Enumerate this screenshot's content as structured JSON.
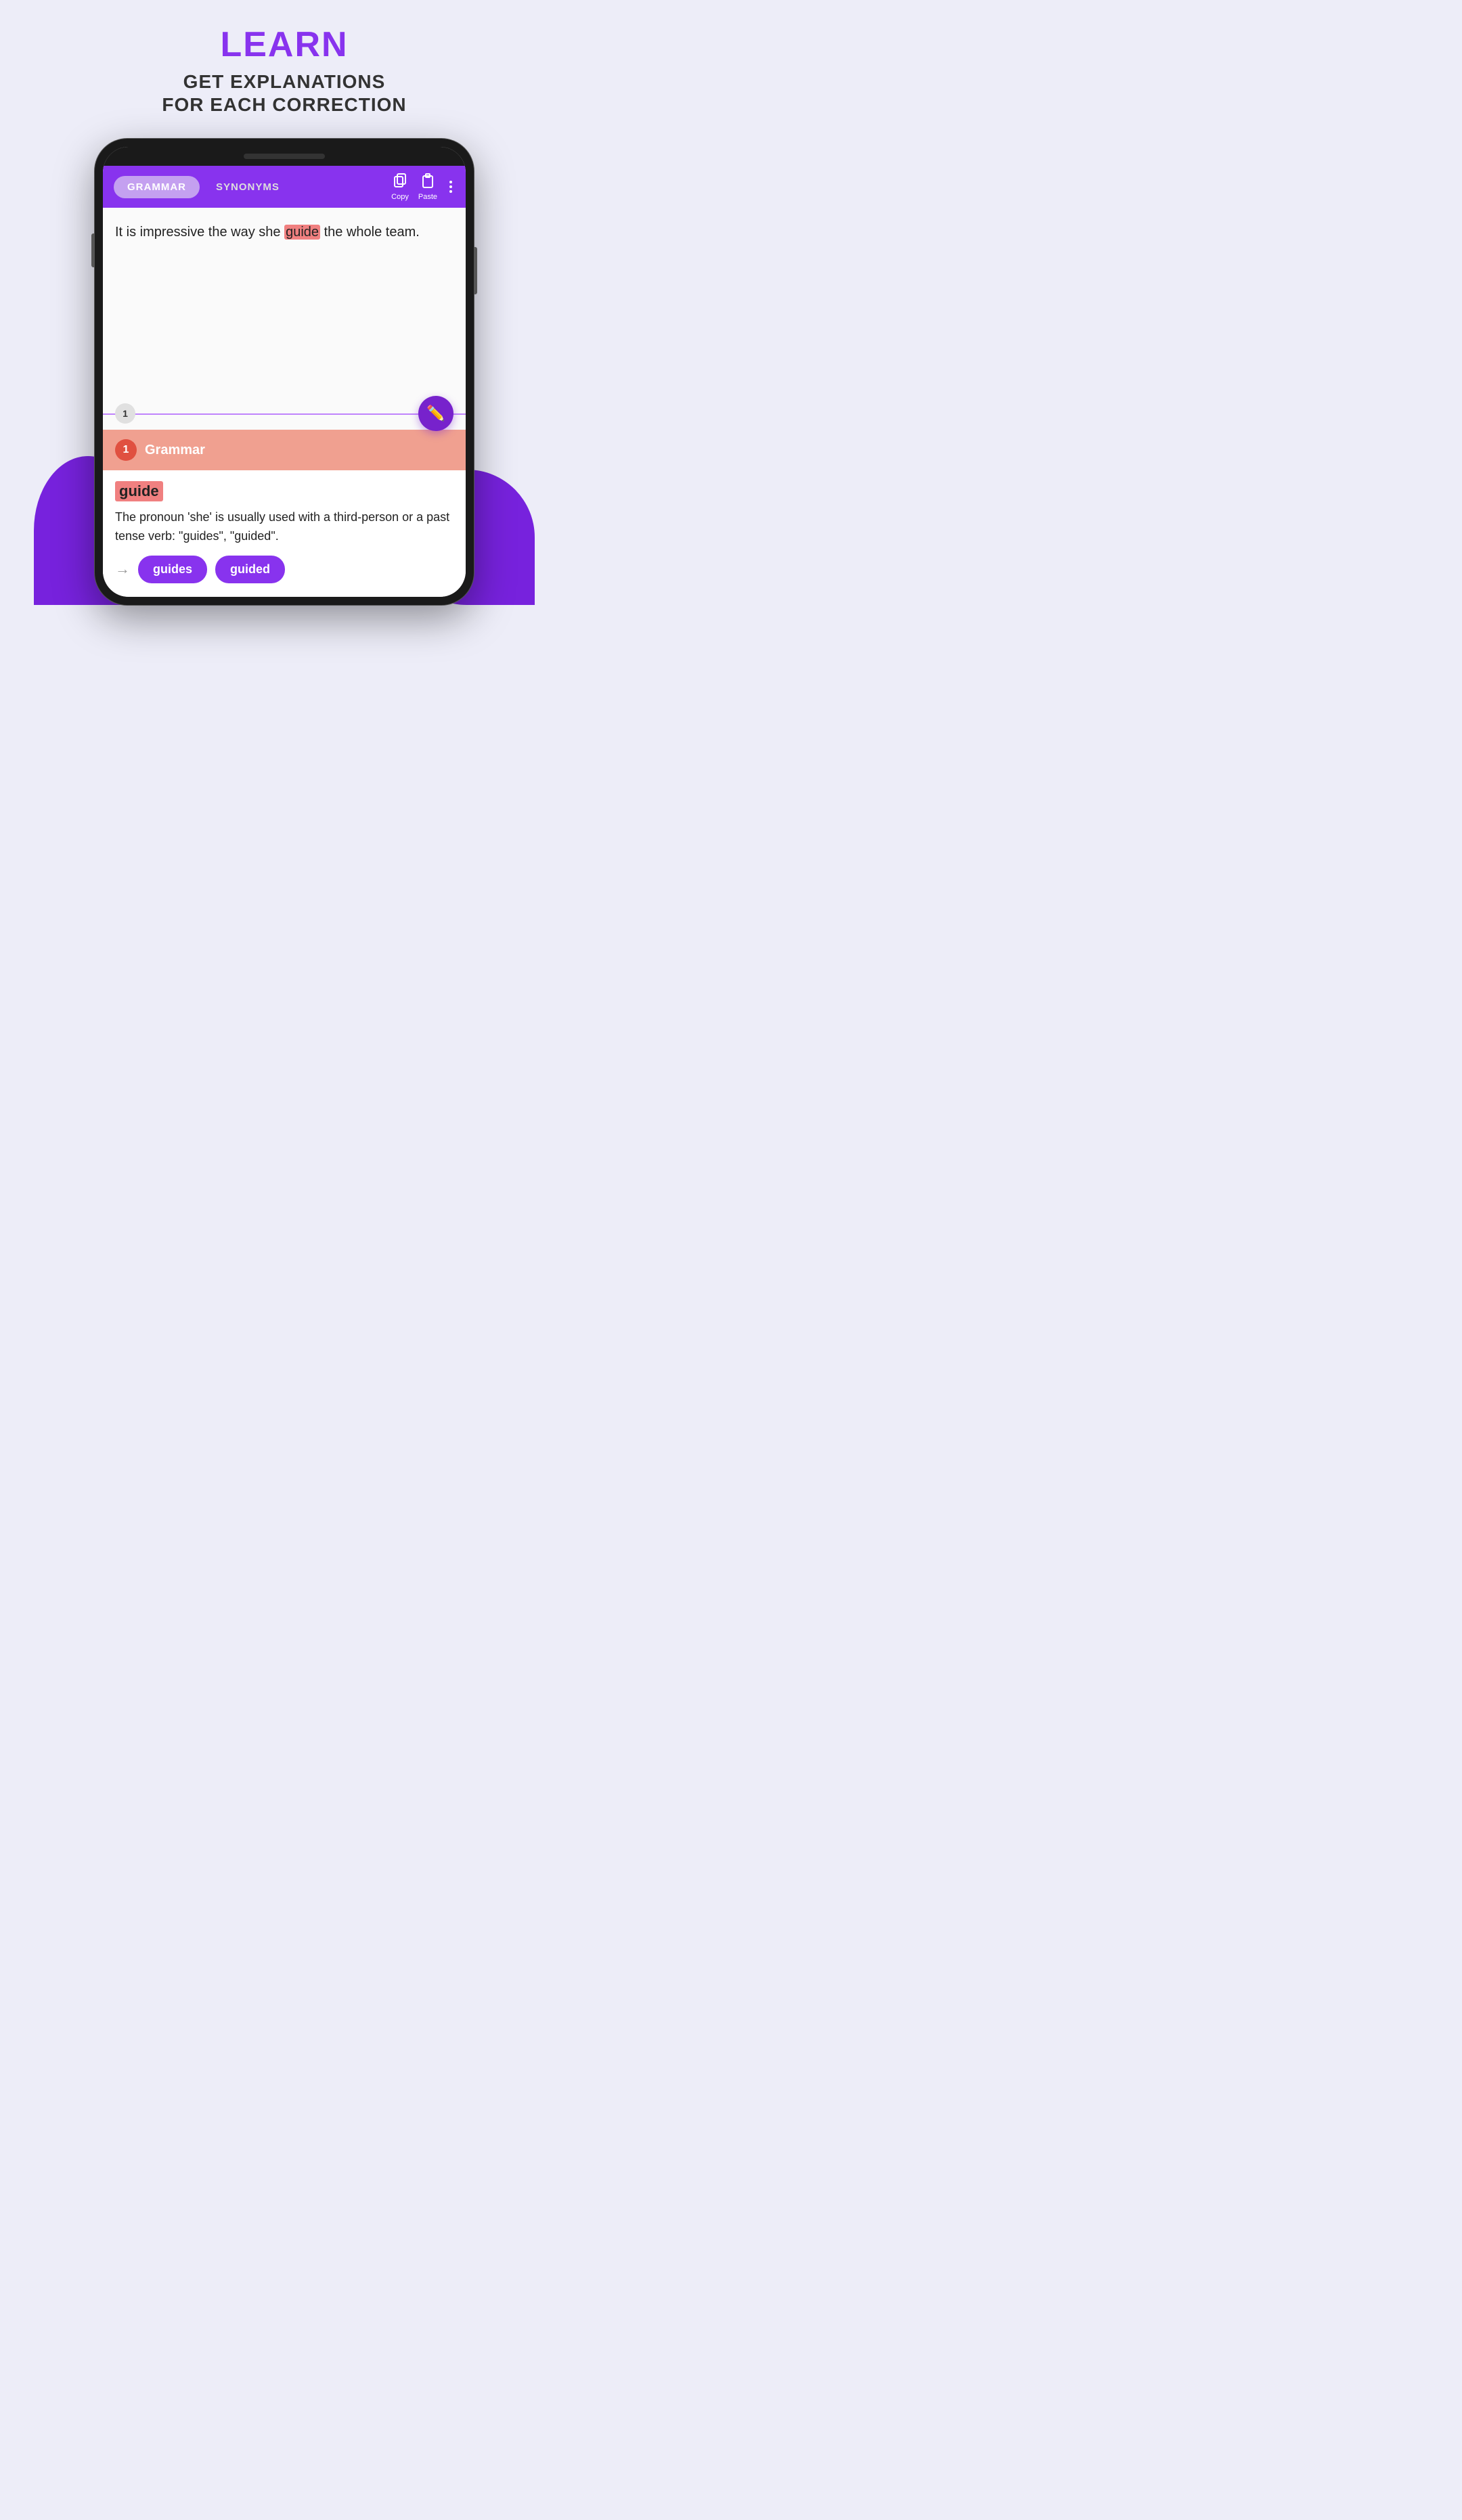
{
  "header": {
    "title": "LEARN",
    "subtitle_line1": "GET EXPLANATIONS",
    "subtitle_line2": "FOR EACH CORRECTION"
  },
  "app_bar": {
    "tab_grammar": "GRAMMAR",
    "tab_synonyms": "SYNONYMS",
    "copy_label": "Copy",
    "paste_label": "Paste"
  },
  "text_content": {
    "before_highlight": "It is impressive the way she ",
    "highlighted": "guide",
    "after_highlight": " the whole team."
  },
  "divider": {
    "number": "1"
  },
  "grammar_card": {
    "badge_number": "1",
    "title": "Grammar",
    "error_word": "guide",
    "explanation": "The pronoun 'she' is usually used with a third-person or a past tense verb: \"guides\", \"guided\".",
    "suggestion1": "guides",
    "suggestion2": "guided"
  }
}
